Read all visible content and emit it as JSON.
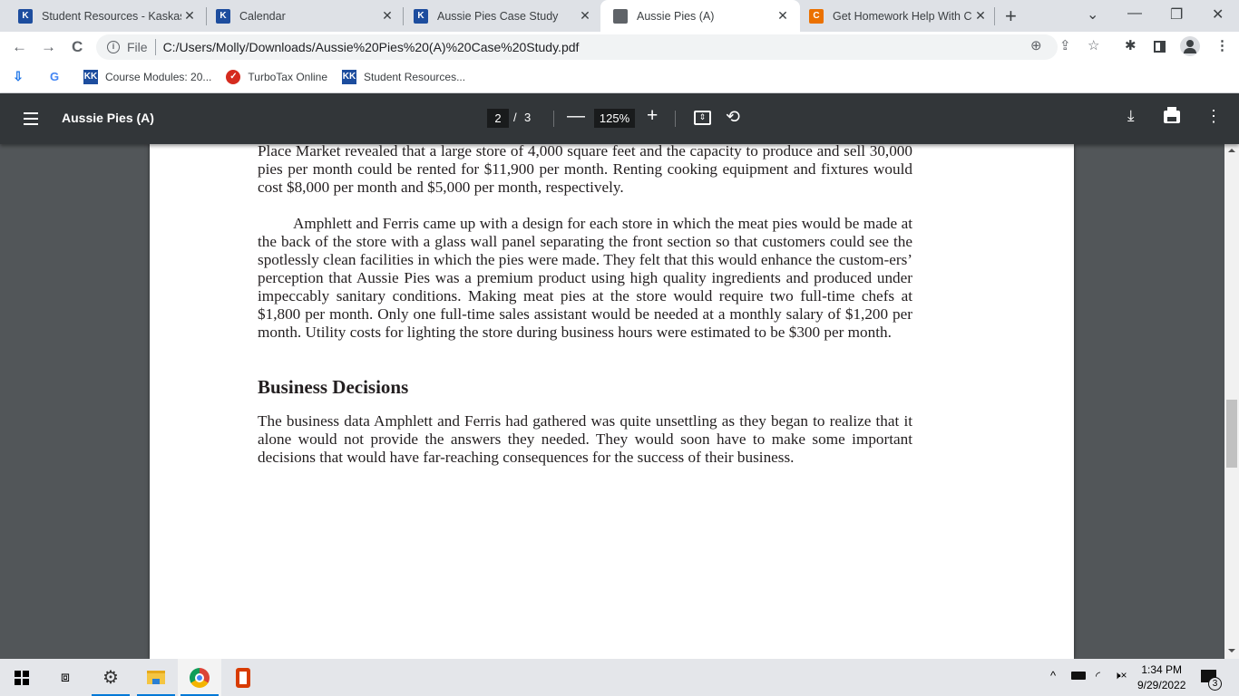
{
  "tabs": [
    {
      "title": "Student Resources - Kaskaskia",
      "favicon": "kc-logo-icon",
      "active": false
    },
    {
      "title": "Calendar",
      "favicon": "kc-logo-icon",
      "active": false
    },
    {
      "title": "Aussie Pies Case Study",
      "favicon": "kc-logo-icon",
      "active": false
    },
    {
      "title": "Aussie Pies (A)",
      "favicon": "globe-icon",
      "active": true
    },
    {
      "title": "Get Homework Help With Chegg",
      "favicon": "chegg-icon",
      "active": false
    }
  ],
  "tab_close_glyph": "✕",
  "new_tab_glyph": "+",
  "window_controls": {
    "tab_search": "⌄",
    "minimize": "—",
    "restore": "❐",
    "close": "✕"
  },
  "nav": {
    "back": "←",
    "forward": "→",
    "reload": "C"
  },
  "address": {
    "info_glyph": "i",
    "scheme_label": "File",
    "url": "C:/Users/Molly/Downloads/Aussie%20Pies%20(A)%20Case%20Study.pdf"
  },
  "omnibox_icons": {
    "zoom": "⊕",
    "share": "⇪",
    "bookmark": "☆"
  },
  "toolbar_icons": {
    "extensions": "✱",
    "side_panel": "▯",
    "profile": "●",
    "menu": "⋮"
  },
  "bookmarks": [
    {
      "label": "",
      "icon": "download-cloud-icon"
    },
    {
      "label": "",
      "icon": "google-icon"
    },
    {
      "label": "Course Modules: 20...",
      "icon": "kc-logo-icon"
    },
    {
      "label": "TurboTax Online",
      "icon": "turbotax-check-icon"
    },
    {
      "label": "Student Resources...",
      "icon": "kc-logo-icon"
    }
  ],
  "pdf_toolbar": {
    "title": "Aussie Pies (A)",
    "current_page": "2",
    "page_separator": "/",
    "total_pages": "3",
    "zoom": "125%",
    "zoom_out": "—",
    "zoom_in": "+",
    "rotate": "⟲",
    "download": "⤓",
    "more": "⋮"
  },
  "document": {
    "para1": "Place Market revealed that a large store of 4,000 square feet and the capacity to produce and sell 30,000 pies per month could be rented for $11,900 per month. Renting cooking equipment and fixtures would cost $8,000 per month and $5,000 per month, respectively.",
    "para2": "Amphlett and Ferris came up with a design for each store in which the meat pies would be made at the back of the store with a glass wall panel separating the front section so that customers could see the spotlessly clean facilities in which the pies were made. They felt that this would enhance the custom-ers’ perception that Aussie Pies was a premium product using high quality ingredients and produced under impeccably sanitary conditions. Making meat pies at the store would require two full-time chefs at $1,800 per month. Only one full-time sales assistant would be needed at a monthly salary of $1,200 per month. Utility costs for lighting the store during business hours were estimated to be $300 per month.",
    "heading": "Business Decisions",
    "para3": "The business data Amphlett and Ferris had gathered was quite unsettling as they began to realize that it alone would not provide the answers they needed. They would soon have to make some important decisions that would have far-reaching consequences for the success of their business."
  },
  "taskbar": {
    "apps": [
      "start",
      "task-view",
      "settings",
      "file-explorer",
      "chrome",
      "office"
    ],
    "time": "1:34 PM",
    "date": "9/29/2022",
    "notification_count": "3",
    "tray_glyphs": {
      "chevron": "^",
      "battery": "▭",
      "wifi": "◜",
      "volume": "🕨×"
    }
  },
  "colors": {
    "pdf_toolbar_bg": "#323639",
    "viewer_bg": "#525659",
    "tab_strip_bg": "#dee1e6",
    "kc_blue": "#1d4d9e",
    "chegg_orange": "#eb7100"
  }
}
